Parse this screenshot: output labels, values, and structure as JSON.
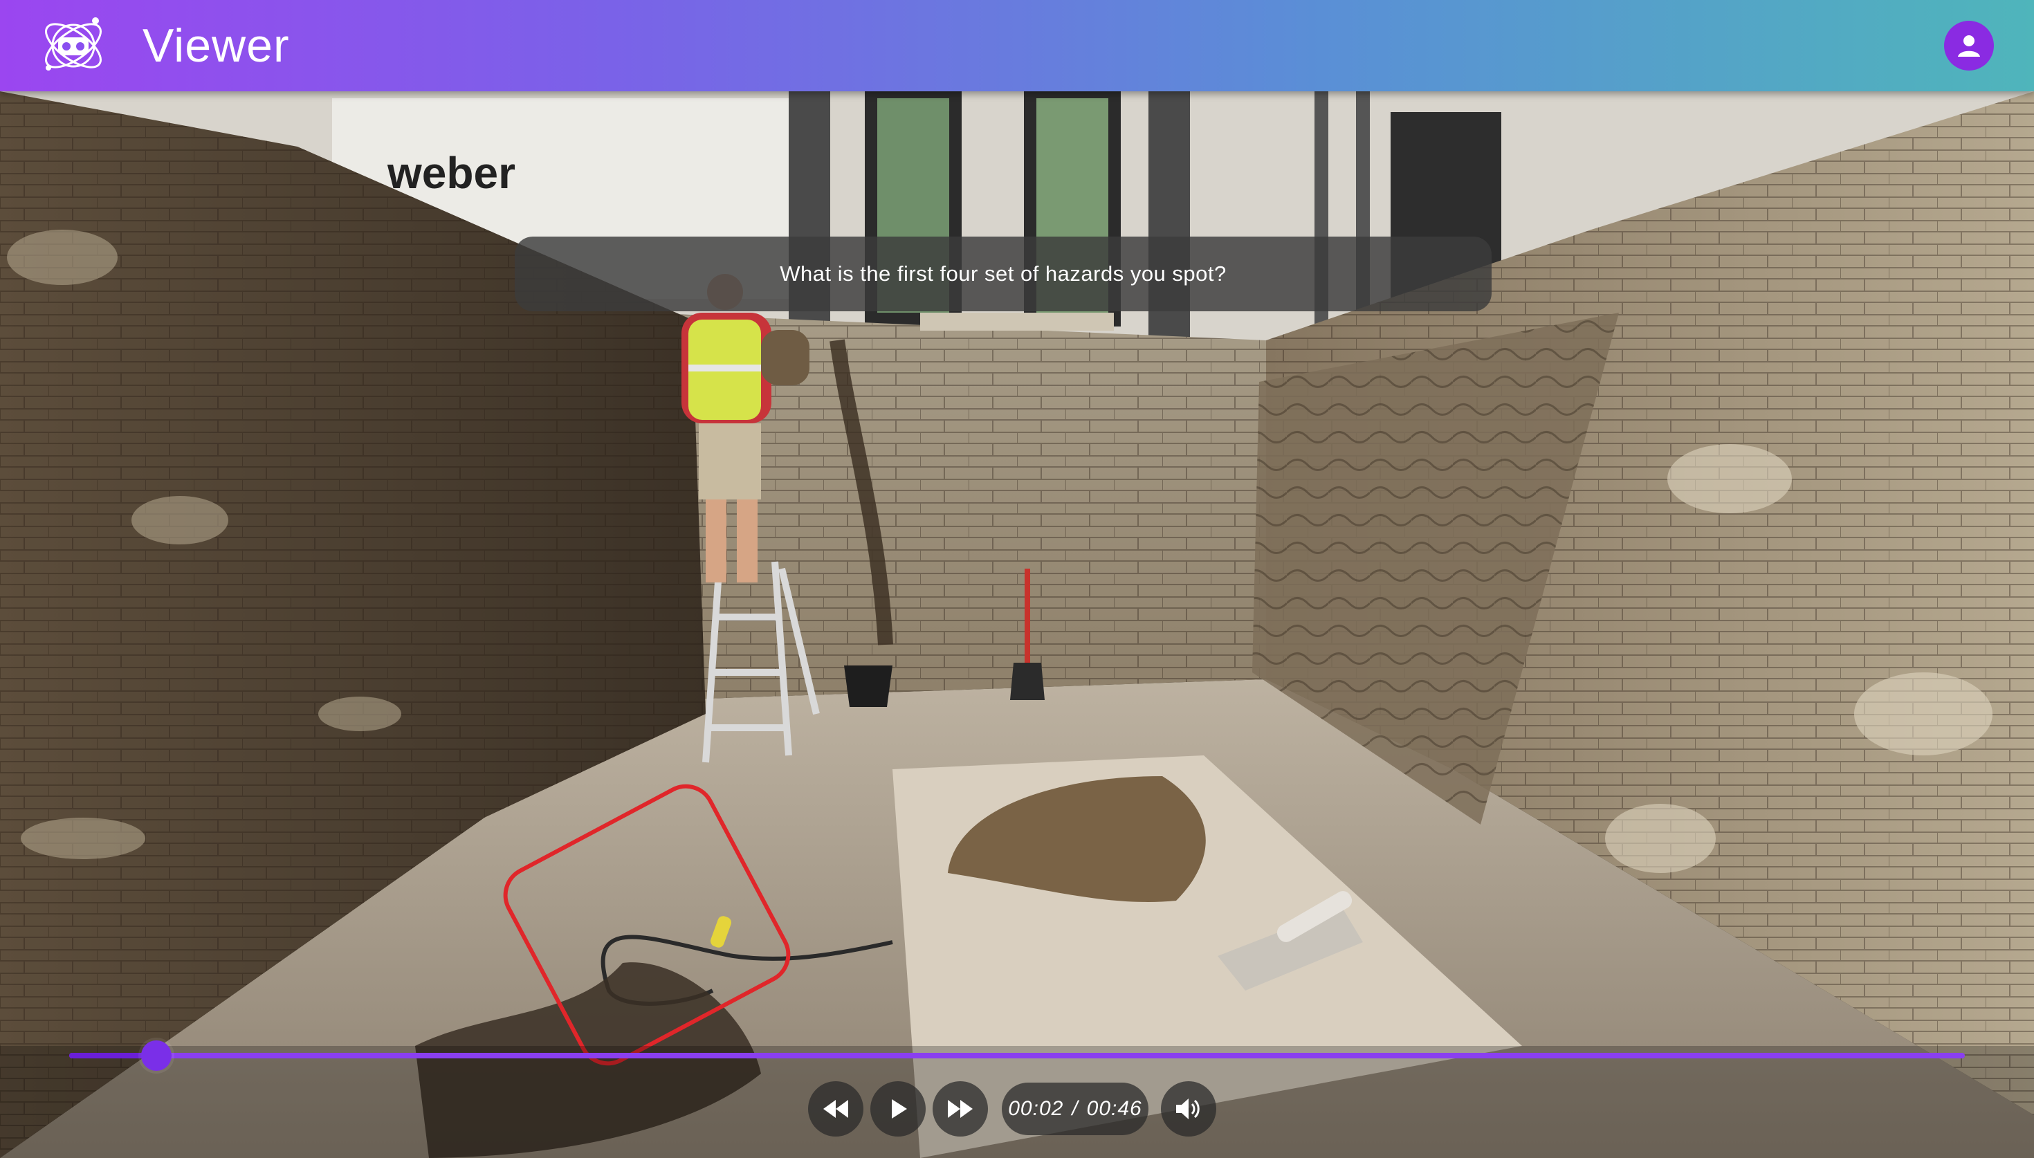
{
  "app": {
    "title": "Viewer",
    "brand_color": "#8a2be2",
    "logo_icon": "vr-headset-orbit-icon",
    "account_icon": "account-circle-icon"
  },
  "scene": {
    "question": "What is the first four set of hazards you spot?",
    "banner_text": "weber",
    "hotspot_color": "#e0262a"
  },
  "player": {
    "current_time": "00:02",
    "separator": "/",
    "duration": "00:46",
    "progress_fraction": 0.046,
    "accent_color": "#8a3ff0",
    "controls": {
      "rewind_icon": "rewind-icon",
      "play_icon": "play-icon",
      "forward_icon": "fast-forward-icon",
      "volume_icon": "volume-up-icon"
    }
  }
}
